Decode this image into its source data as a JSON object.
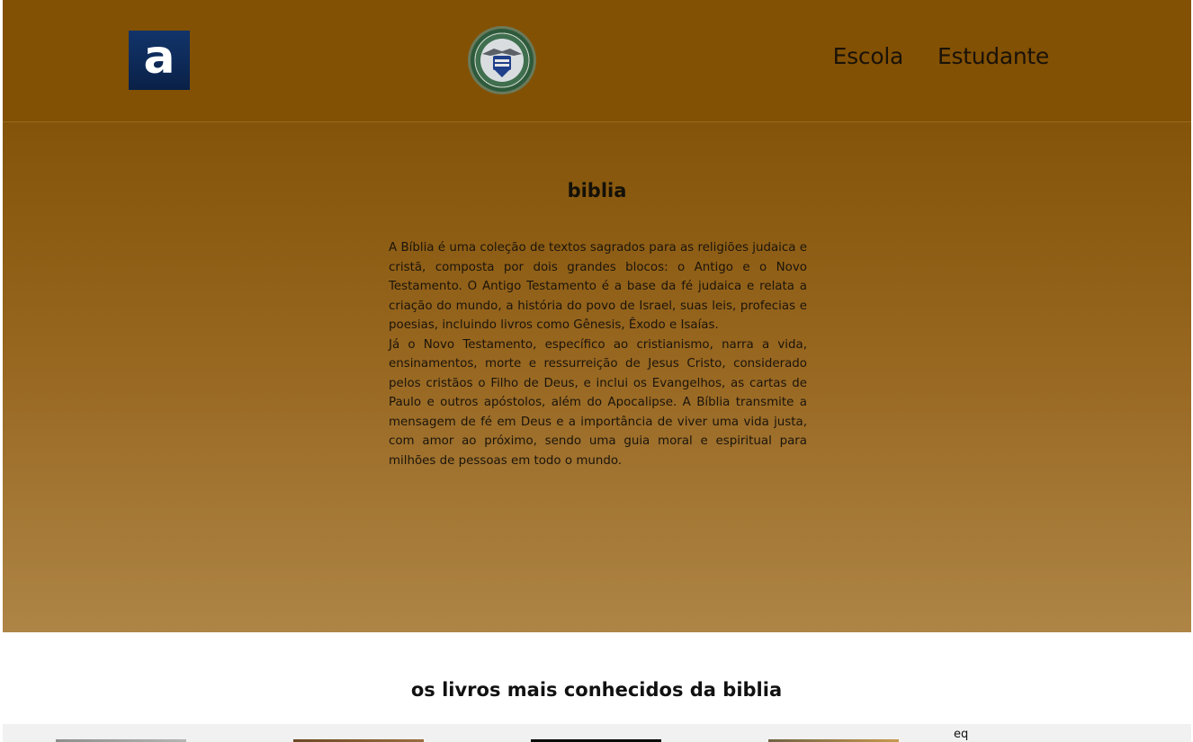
{
  "header": {
    "brand_logo_letter": "a",
    "nav": {
      "escola": "Escola",
      "estudante": "Estudante"
    }
  },
  "hero": {
    "title": "biblia",
    "paragraphs": [
      "A Bíblia é uma coleção de textos sagrados para as religiões judaica e cristã, composta por dois grandes blocos: o Antigo e o Novo Testamento. O Antigo Testamento é a base da fé judaica e relata a criação do mundo, a história do povo de Israel, suas leis, profecias e poesias, incluindo livros como Gênesis, Êxodo e Isaías.",
      "Já o Novo Testamento, específico ao cristianismo, narra a vida, ensinamentos, morte e ressurreição de Jesus Cristo, considerado pelos cristãos o Filho de Deus, e inclui os Evangelhos, as cartas de Paulo e outros apóstolos, além do Apocalipse. A Bíblia transmite a mensagem de fé em Deus e a importância de viver uma vida justa, com amor ao próximo, sendo uma guia moral e espiritual para milhões de pessoas em todo o mundo."
    ]
  },
  "books": {
    "title": "os livros mais conhecidos da biblia",
    "caption": "eq"
  },
  "colors": {
    "header_bg": "#835104",
    "hero_gradient_top": "#835409",
    "hero_gradient_bottom": "#ae8546",
    "text_dark": "#1b140b"
  }
}
